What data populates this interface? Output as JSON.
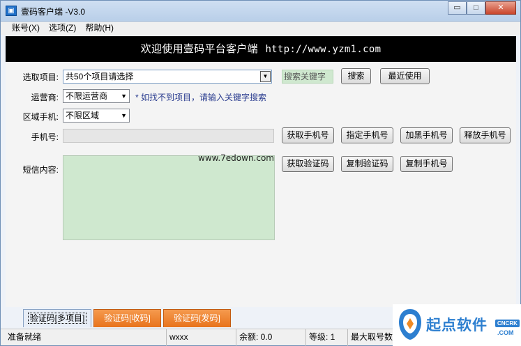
{
  "window": {
    "title": "壹码客户端 -V3.0",
    "icon": "app-window-icon",
    "controls": {
      "minimize": "▭",
      "maximize": "□",
      "close": "✕"
    }
  },
  "menu": {
    "items": [
      "账号(X)",
      "选项(Z)",
      "帮助(H)"
    ]
  },
  "banner": {
    "welcome": "欢迎使用壹码平台客户端",
    "url": "http://www.yzm1.com"
  },
  "form": {
    "project_label": "选取项目:",
    "project_value": "共50个项目请选择",
    "keyword_placeholder": "搜索关键字",
    "search_button": "搜索",
    "recent_button": "最近使用",
    "carrier_label": "运营商:",
    "carrier_value": "不限运营商",
    "hint": "* 如找不到项目，请输入关键字搜索",
    "region_label": "区域手机:",
    "region_value": "不限区域",
    "phone_label": "手机号:",
    "phone_value": "",
    "get_phone_button": "获取手机号",
    "specify_phone_button": "指定手机号",
    "blacklist_phone_button": "加黑手机号",
    "release_phone_button": "释放手机号",
    "sms_label": "短信内容:",
    "sms_value": "",
    "get_code_button": "获取验证码",
    "copy_code_button": "复制验证码",
    "copy_phone_button": "复制手机号",
    "watermark": "www.7edown.com"
  },
  "tabs": [
    "验证码[多项目]",
    "验证码[收码]",
    "验证码[发码]"
  ],
  "status": {
    "ready": "准备就绪",
    "user": "wxxx",
    "balance": "余额: 0.0",
    "level": "等级: 1",
    "max_count": "最大取号数"
  },
  "logo": {
    "text": "起点软件",
    "badge": "CNCRK",
    "domain": ".COM"
  },
  "colors": {
    "banner_bg": "#000000",
    "sms_bg": "#cfe8cf",
    "tab_orange": "#e8731c",
    "logo_blue": "#2d7fd0"
  }
}
